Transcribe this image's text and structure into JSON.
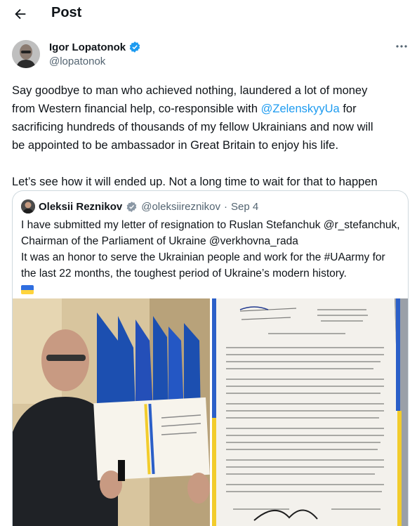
{
  "header": {
    "title": "Post"
  },
  "author": {
    "name": "Igor Lopatonok",
    "handle": "@lopatonok"
  },
  "tweet": {
    "l1": "Say goodbye to man who achieved nothing, laundered a lot of money",
    "l2a": "from Western financial help, co-responsible with ",
    "l2m": "@ZelenskyyUa",
    "l2b": " for",
    "l3": "sacrificing hundreds of thousands of my fellow Ukrainians and now will",
    "l4": "be appointed to be ambassador in Great Britain to enjoy his life.",
    "l5": "Let’s see how it will ended up. Not a long time to wait for that to happen"
  },
  "quote": {
    "name": "Oleksii Reznikov",
    "handle": "@oleksiireznikov",
    "dot": "·",
    "date": "Sep 4",
    "l1": "I have submitted my letter of resignation to Ruslan Stefanchuk @r_stefanchuk,",
    "l2": "Chairman of the Parliament of Ukraine @verkhovna_rada",
    "l3": "It was an honor to serve the Ukrainian people and work for the #UAarmy for",
    "l4": "the last 22 months, the toughest period of Ukraine’s modern history."
  },
  "icons": {
    "back": "arrow-left-icon",
    "verified": "verified-badge-icon",
    "more": "more-dots-icon",
    "flag": "ukraine-flag-icon"
  },
  "colors": {
    "link": "#1d9bf0",
    "verified": "#1d9bf0",
    "secondary_text": "#536471",
    "border": "#cfd9de",
    "flag_blue": "#2f6ee0",
    "flag_yellow": "#ffd43b"
  }
}
